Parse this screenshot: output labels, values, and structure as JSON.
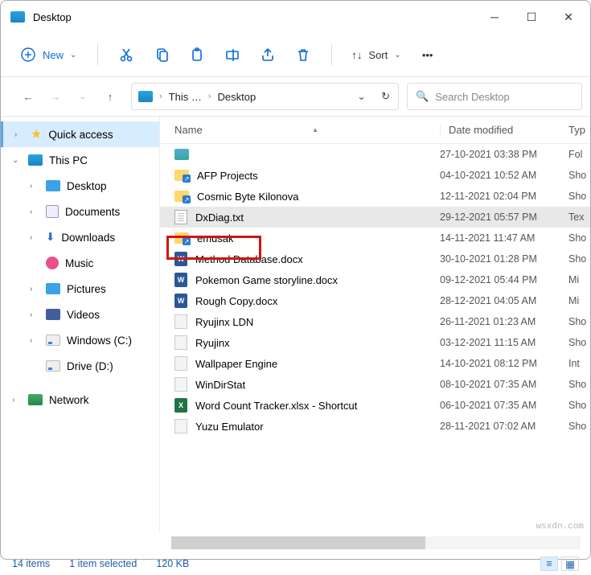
{
  "window": {
    "title": "Desktop"
  },
  "toolbar": {
    "new_label": "New",
    "sort_label": "Sort"
  },
  "breadcrumb": {
    "seg1": "This …",
    "seg2": "Desktop"
  },
  "search": {
    "placeholder": "Search Desktop"
  },
  "sidebar": {
    "quick_access": "Quick access",
    "this_pc": "This PC",
    "desktop": "Desktop",
    "documents": "Documents",
    "downloads": "Downloads",
    "music": "Music",
    "pictures": "Pictures",
    "videos": "Videos",
    "windows_c": "Windows (C:)",
    "drive_d": "Drive (D:)",
    "network": "Network"
  },
  "columns": {
    "name": "Name",
    "date": "Date modified",
    "type": "Typ"
  },
  "files": [
    {
      "name": "",
      "date": "27-10-2021 03:38 PM",
      "type": "Fol",
      "icon": "img"
    },
    {
      "name": "AFP Projects",
      "date": "04-10-2021 10:52 AM",
      "type": "Sho",
      "icon": "folder"
    },
    {
      "name": "Cosmic Byte Kilonova",
      "date": "12-11-2021 02:04 PM",
      "type": "Sho",
      "icon": "folder"
    },
    {
      "name": "DxDiag.txt",
      "date": "29-12-2021 05:57 PM",
      "type": "Tex",
      "icon": "txt",
      "selected": true
    },
    {
      "name": "emusak",
      "date": "14-11-2021 11:47 AM",
      "type": "Sho",
      "icon": "folder"
    },
    {
      "name": "Method Database.docx",
      "date": "30-10-2021 01:28 PM",
      "type": "Sho",
      "icon": "word"
    },
    {
      "name": "Pokemon Game storyline.docx",
      "date": "09-12-2021 05:44 PM",
      "type": "Mi",
      "icon": "word"
    },
    {
      "name": "Rough Copy.docx",
      "date": "28-12-2021 04:05 AM",
      "type": "Mi",
      "icon": "word"
    },
    {
      "name": "Ryujinx LDN",
      "date": "26-11-2021 01:23 AM",
      "type": "Sho",
      "icon": "gen"
    },
    {
      "name": "Ryujinx",
      "date": "03-12-2021 11:15 AM",
      "type": "Sho",
      "icon": "gen"
    },
    {
      "name": "Wallpaper Engine",
      "date": "14-10-2021 08:12 PM",
      "type": "Int",
      "icon": "gen"
    },
    {
      "name": "WinDirStat",
      "date": "08-10-2021 07:35 AM",
      "type": "Sho",
      "icon": "gen"
    },
    {
      "name": "Word Count Tracker.xlsx - Shortcut",
      "date": "06-10-2021 07:35 AM",
      "type": "Sho",
      "icon": "excel"
    },
    {
      "name": "Yuzu Emulator",
      "date": "28-11-2021 07:02 AM",
      "type": "Sho",
      "icon": "gen"
    }
  ],
  "status": {
    "count": "14 items",
    "selected": "1 item selected",
    "size": "120 KB"
  },
  "watermark": "wsxdn.com"
}
